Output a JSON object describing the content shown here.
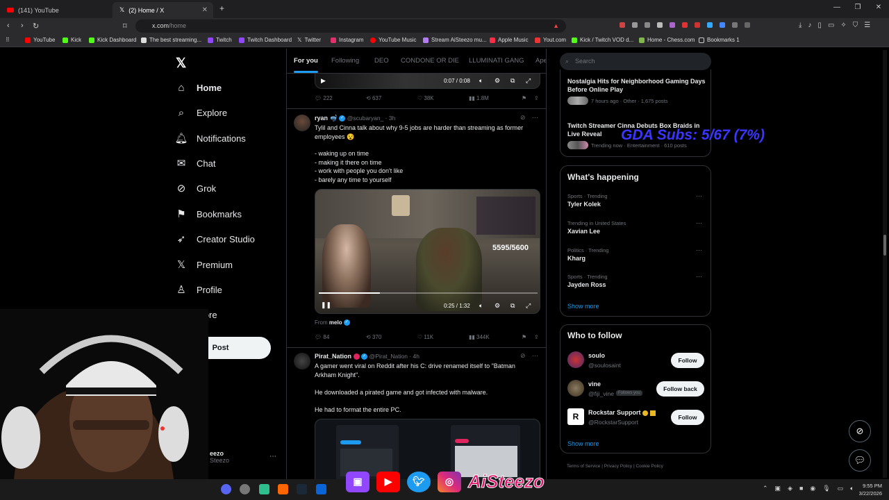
{
  "browser": {
    "tabs": [
      {
        "label": "(141) YouTube"
      },
      {
        "label": "(2) Home / X"
      }
    ],
    "url": {
      "host": "x.com",
      "path": "/home"
    },
    "bookmarks": [
      "YouTube",
      "Kick",
      "Kick Dashboard",
      "The best streaming...",
      "Twitch",
      "Twitch Dashboard",
      "Twitter",
      "Instagram",
      "YouTube Music",
      "Stream AiSteezo mu...",
      "Apple Music",
      "Yout.com",
      "Kick / Twitch VOD d...",
      "Home - Chess.com",
      "Bookmarks 1"
    ]
  },
  "x": {
    "nav": [
      {
        "label": "Home",
        "icon": "home-icon"
      },
      {
        "label": "Explore",
        "icon": "search-icon"
      },
      {
        "label": "Notifications",
        "icon": "bell-icon"
      },
      {
        "label": "Chat",
        "icon": "mail-icon"
      },
      {
        "label": "Grok",
        "icon": "grok-icon"
      },
      {
        "label": "Bookmarks",
        "icon": "bookmark-icon"
      },
      {
        "label": "Creator Studio",
        "icon": "rocket-icon"
      },
      {
        "label": "Premium",
        "icon": "x-icon"
      },
      {
        "label": "Profile",
        "icon": "person-icon"
      },
      {
        "label": "More",
        "icon": "more-icon"
      }
    ],
    "post_label": "Post",
    "account": {
      "name": "eezo",
      "handle": "Steezo"
    },
    "feed_tabs": [
      "For you",
      "Following",
      "DEO",
      "CONDONE OR DIE",
      "LLUMINATI GANG",
      "Ape"
    ],
    "post0": {
      "video_time": "0:07 / 0:08",
      "replies": "222",
      "reposts": "637",
      "likes": "38K",
      "views": "1.8M"
    },
    "post1": {
      "name": "ryan",
      "handle": "@scubaryan_",
      "time": "3h",
      "text": "Tylil and Cinna talk about why 9-5 jobs are harder than streaming as former employees 😵",
      "bullets": [
        "- waking up on time",
        "- making it there on time",
        "- work with people you don't like",
        "- barely any time to yourself"
      ],
      "video_overlay": "5595/5600",
      "video_time": "0:25 / 1:32",
      "from_label": "From",
      "from_name": "melo",
      "replies": "84",
      "reposts": "370",
      "likes": "11K",
      "views": "344K"
    },
    "post2": {
      "name": "Pirat_Nation",
      "handle": "@Pirat_Nation",
      "time": "4h",
      "line1": "A gamer went viral on Reddit after his C: drive renamed itself to \"Batman Arkham Knight\".",
      "line2": "He downloaded a pirated game and got infected with malware.",
      "line3": "He had to format the entire PC."
    },
    "search_placeholder": "Search",
    "news": [
      {
        "title": "Nostalgia Hits for Neighborhood Gaming Days Before Online Play",
        "meta": "7 hours ago · Other · 1,675 posts"
      },
      {
        "title": "Twitch Streamer Cinna Debuts Box Braids in Live Reveal",
        "meta": "Trending now · Entertainment · 610 posts"
      }
    ],
    "happening": {
      "title": "What's happening",
      "items": [
        {
          "context": "Sports · Trending",
          "name": "Tyler Kolek"
        },
        {
          "context": "Trending in United States",
          "name": "Xavian Lee"
        },
        {
          "context": "Politics · Trending",
          "name": "Kharg"
        },
        {
          "context": "Sports · Trending",
          "name": "Jayden Ross"
        }
      ],
      "show_more": "Show more"
    },
    "who_to_follow": {
      "title": "Who to follow",
      "users": [
        {
          "name": "soulo",
          "handle": "@soulosaint",
          "button": "Follow",
          "badge": ""
        },
        {
          "name": "vine",
          "handle": "@fiji_vine",
          "button": "Follow back",
          "badge": "Follows you"
        },
        {
          "name": "Rockstar Support",
          "handle": "@RockstarSupport",
          "button": "Follow",
          "badge": ""
        }
      ],
      "show_more": "Show more"
    },
    "footer": "Terms of Service | Privacy Policy | Cookie Policy",
    "overlay": "GDA Subs: 5/67 (7%)"
  },
  "stream": {
    "socials": [
      "Twitch",
      "YouTube",
      "Twitter",
      "Instagram"
    ],
    "brand": "AiSteezo"
  },
  "taskbar": {
    "time": "9:55 PM",
    "date": "3/22/2026"
  }
}
